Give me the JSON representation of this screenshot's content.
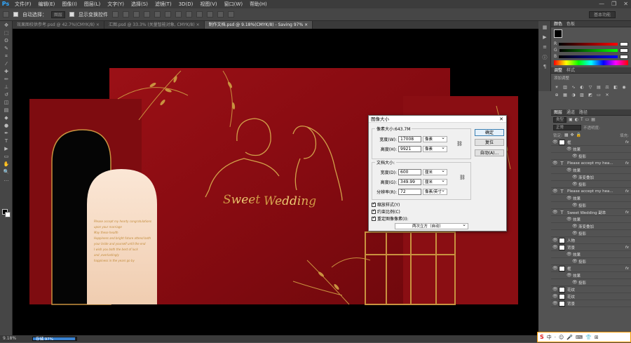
{
  "app": {
    "logo": "Ps"
  },
  "menu": [
    "文件(F)",
    "编辑(E)",
    "图像(I)",
    "图层(L)",
    "文字(Y)",
    "选择(S)",
    "滤镜(T)",
    "3D(D)",
    "视图(V)",
    "窗口(W)",
    "帮助(H)"
  ],
  "window_controls": [
    "—",
    "❐",
    "✕"
  ],
  "options": {
    "auto_select_label": "自动选择：",
    "auto_select_value": "图层",
    "transform_label": "显示变换控件",
    "workspace": "基本功能"
  },
  "tabs": [
    "效果图校供参考.psd @ 42.7%(CMYK/8) ×",
    "汇图.psd @ 33.3% (关量智能对象, CMYK/8) ×",
    "制作文档.psd @ 9.18%(CMYK/8) - Saving 97% ×"
  ],
  "status": {
    "zoom": "9.18%",
    "progress_label": "存储 97%",
    "progress": 0.97
  },
  "colors": {
    "brand": "#31a8ff",
    "canvas_red": "#8f0d12",
    "gold": "#d2a24a",
    "dialog_bg": "#f0f0f0"
  },
  "artwork": {
    "sweet": "Sweet",
    "wedding": "Wedding",
    "invite_lines": [
      "Please accept my hearty congratulations",
      "upon your marriage",
      "May these health",
      "Happiness and bright future attend both",
      "your bride and yourself until the end",
      "I wish you both the best of luck",
      "and ,everlastingly",
      "happiness in the years go by"
    ]
  },
  "color_panel": {
    "tabs": [
      "颜色",
      "色板"
    ],
    "channels": [
      "R",
      "G",
      "B"
    ]
  },
  "adjust_panel": {
    "tabs": [
      "调整",
      "样式"
    ],
    "hint": "添加调整"
  },
  "layers_panel": {
    "tabs": [
      "图层",
      "通道",
      "路径"
    ],
    "kind_label": "类型",
    "blend_mode": "正常",
    "opacity_label": "不透明度:",
    "lock_label": "锁定:",
    "fill_label": "填充:",
    "layers": [
      {
        "name": "框",
        "kind": "img",
        "fx": true
      },
      {
        "name": "效果",
        "kind": "sub"
      },
      {
        "name": "投影",
        "kind": "sub2"
      },
      {
        "name": "Please accept my hea...",
        "kind": "text",
        "fx": true
      },
      {
        "name": "效果",
        "kind": "sub"
      },
      {
        "name": "渐变叠加",
        "kind": "sub2"
      },
      {
        "name": "投影",
        "kind": "sub2"
      },
      {
        "name": "Please accept my hea...",
        "kind": "text",
        "fx": true
      },
      {
        "name": "效果",
        "kind": "sub"
      },
      {
        "name": "投影",
        "kind": "sub2"
      },
      {
        "name": "Sweet Wedding 副本",
        "kind": "text",
        "fx": true
      },
      {
        "name": "效果",
        "kind": "sub"
      },
      {
        "name": "渐变叠加",
        "kind": "sub2"
      },
      {
        "name": "投影",
        "kind": "sub2"
      },
      {
        "name": "人物",
        "kind": "img"
      },
      {
        "name": "背景",
        "kind": "img",
        "fx": true
      },
      {
        "name": "效果",
        "kind": "sub"
      },
      {
        "name": "投影",
        "kind": "sub2"
      },
      {
        "name": "框",
        "kind": "img",
        "fx": true
      },
      {
        "name": "效果",
        "kind": "sub"
      },
      {
        "name": "投影",
        "kind": "sub2"
      },
      {
        "name": "花纹",
        "kind": "img"
      },
      {
        "name": "花纹",
        "kind": "img"
      },
      {
        "name": "背景",
        "kind": "img"
      }
    ]
  },
  "dialog": {
    "title": "图像大小",
    "close": "✕",
    "pixel_dims": "像素大小:643.7M",
    "width_label": "宽度(W):",
    "width_value": "17008",
    "height_label": "高度(H):",
    "height_value": "9921",
    "pixel_unit": "像素",
    "doc_size": "文档大小:",
    "doc_width_label": "宽度(D):",
    "doc_width_value": "600",
    "doc_height_label": "高度(G):",
    "doc_height_value": "349.99",
    "cm_unit": "厘米",
    "res_label": "分辨率(R):",
    "res_value": "72",
    "res_unit": "像素/英寸",
    "ok": "确定",
    "reset": "复位",
    "auto": "自动(A)...",
    "scale_styles": "缩放样式(Y)",
    "constrain": "约束比例(C)",
    "resample": "重定图像像素(I):",
    "resample_method": "两次立方（自动）"
  },
  "ime": {
    "logo": "S",
    "items": [
      "中",
      "·",
      "☺",
      "🎤",
      "⌨",
      "👕",
      "⊞"
    ]
  }
}
